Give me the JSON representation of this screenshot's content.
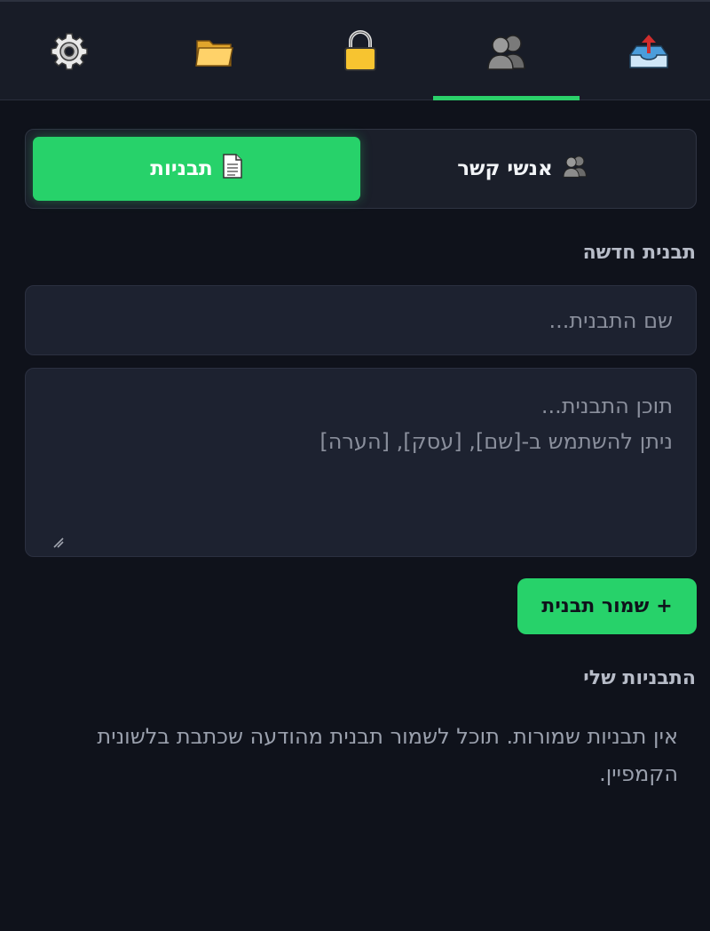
{
  "nav": {
    "tabs": [
      {
        "name": "settings",
        "icon": "gear-icon"
      },
      {
        "name": "files",
        "icon": "folder-icon"
      },
      {
        "name": "lock",
        "icon": "lock-icon"
      },
      {
        "name": "contacts",
        "icon": "people-icon",
        "active": true
      },
      {
        "name": "outbox",
        "icon": "outbox-tray-icon"
      }
    ]
  },
  "segment": {
    "templates_label": "תבניות",
    "templates_icon": "document-icon",
    "contacts_label": "אנשי קשר",
    "contacts_icon": "people-icon",
    "active": "templates"
  },
  "new_template": {
    "title": "תבנית חדשה",
    "name_placeholder": "שם התבנית...",
    "content_placeholder": "תוכן התבנית...\nניתן להשתמש ב-[שם], [עסק], [הערה]",
    "save_label": "שמור תבנית",
    "save_icon": "+"
  },
  "my_templates": {
    "title": "התבניות שלי",
    "empty_message": "אין תבניות שמורות. תוכל לשמור תבנית מהודעה שכתבת בלשונית הקמפיין."
  },
  "colors": {
    "accent": "#27d26a",
    "background": "#0f121b",
    "surface": "#1d2230"
  }
}
